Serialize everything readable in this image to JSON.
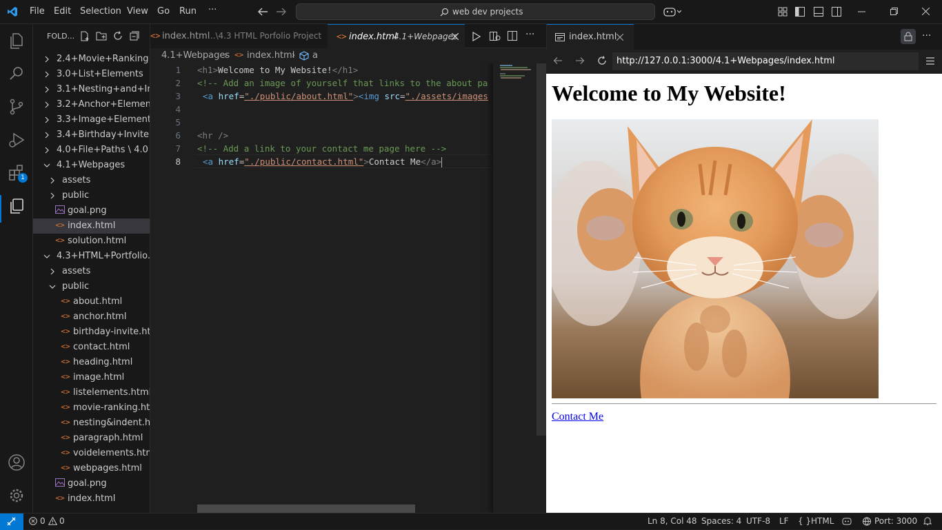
{
  "titlebar": {
    "menu": [
      "File",
      "Edit",
      "Selection",
      "View",
      "Go",
      "Run",
      "···"
    ],
    "search_text": "web dev projects"
  },
  "activitybar": {
    "extensions_badge": "1"
  },
  "sidebar": {
    "header": "FOLD...",
    "items": [
      {
        "label": "2.4+Movie+Ranking+...",
        "kind": "folder",
        "open": false
      },
      {
        "label": "3.0+List+Elements",
        "kind": "folder",
        "open": false
      },
      {
        "label": "3.1+Nesting+and+In...",
        "kind": "folder",
        "open": false
      },
      {
        "label": "3.2+Anchor+Elements",
        "kind": "folder",
        "open": false
      },
      {
        "label": "3.3+Image+Elements...",
        "kind": "folder",
        "open": false
      },
      {
        "label": "3.4+Birthday+Invite+...",
        "kind": "folder",
        "open": false
      },
      {
        "label": "4.0+File+Paths \\ 4.0 Fi...",
        "kind": "folder",
        "open": false
      },
      {
        "label": "4.1+Webpages",
        "kind": "folder",
        "open": true
      },
      {
        "label": "assets",
        "kind": "folder",
        "open": false
      },
      {
        "label": "public",
        "kind": "folder",
        "open": false
      },
      {
        "label": "goal.png",
        "kind": "image"
      },
      {
        "label": "index.html",
        "kind": "html",
        "selected": true
      },
      {
        "label": "solution.html",
        "kind": "html"
      },
      {
        "label": "4.3+HTML+Portfolio...",
        "kind": "folder",
        "open": true
      },
      {
        "label": "assets",
        "kind": "folder",
        "open": false
      },
      {
        "label": "public",
        "kind": "folder",
        "open": true
      },
      {
        "label": "about.html",
        "kind": "html"
      },
      {
        "label": "anchor.html",
        "kind": "html"
      },
      {
        "label": "birthday-invite.html",
        "kind": "html"
      },
      {
        "label": "contact.html",
        "kind": "html"
      },
      {
        "label": "heading.html",
        "kind": "html"
      },
      {
        "label": "image.html",
        "kind": "html"
      },
      {
        "label": "listelements.html",
        "kind": "html"
      },
      {
        "label": "movie-ranking.html",
        "kind": "html"
      },
      {
        "label": "nesting&indent.html",
        "kind": "html"
      },
      {
        "label": "paragraph.html",
        "kind": "html"
      },
      {
        "label": "voidelements.html",
        "kind": "html"
      },
      {
        "label": "webpages.html",
        "kind": "html"
      },
      {
        "label": "goal.png",
        "kind": "image"
      },
      {
        "label": "index.html",
        "kind": "html"
      }
    ]
  },
  "editor": {
    "tabs": [
      {
        "name": "index.html",
        "desc": "...\\4.3 HTML Porfolio Project",
        "active": false
      },
      {
        "name": "index.html",
        "desc": "4.1+Webpages",
        "active": true
      }
    ],
    "breadcrumb": [
      "4.1+Webpages",
      "index.html",
      "a"
    ],
    "line_numbers": [
      "1",
      "2",
      "3",
      "4",
      "5",
      "6",
      "7",
      "8"
    ],
    "current_line": "8",
    "lines": {
      "l1": {
        "open": "<h1>",
        "text": "Welcome to My Website!",
        "close": "</h1>"
      },
      "l2": {
        "comment": "<!-- Add an image of yourself that links to the about pa"
      },
      "l3": {
        "a_open": "<a ",
        "href_attr": "href",
        "eq": "=",
        "href_val": "\"./public/about.html\"",
        "gt": ">",
        "img_open": "<img ",
        "src_attr": "src",
        "src_val": "\"./assets/images"
      },
      "l6": {
        "hr": "<hr />"
      },
      "l7": {
        "comment": "<!-- Add a link to your contact me page here -->"
      },
      "l8": {
        "a_open": "<a ",
        "href_attr": "href",
        "eq": "=",
        "href_val": "\"./public/contact.html\"",
        "gt": ">",
        "text": "Contact Me",
        "close": "</a>"
      }
    }
  },
  "browser": {
    "tab_title": "index.html",
    "url": "http://127.0.0.1:3000/4.1+Webpages/index.html",
    "page": {
      "heading": "Welcome to My Website!",
      "image_alt": "orange tabby kitten",
      "link_text": "Contact Me"
    }
  },
  "statusbar": {
    "errors": "0",
    "warnings": "0",
    "position": "Ln 8, Col 48",
    "spaces": "Spaces: 4",
    "encoding": "UTF-8",
    "eol": "LF",
    "language": "HTML",
    "port": "Port: 3000"
  },
  "colors": {
    "accent": "#0078d4",
    "html_icon": "#e37933",
    "link": "#0000ee"
  }
}
